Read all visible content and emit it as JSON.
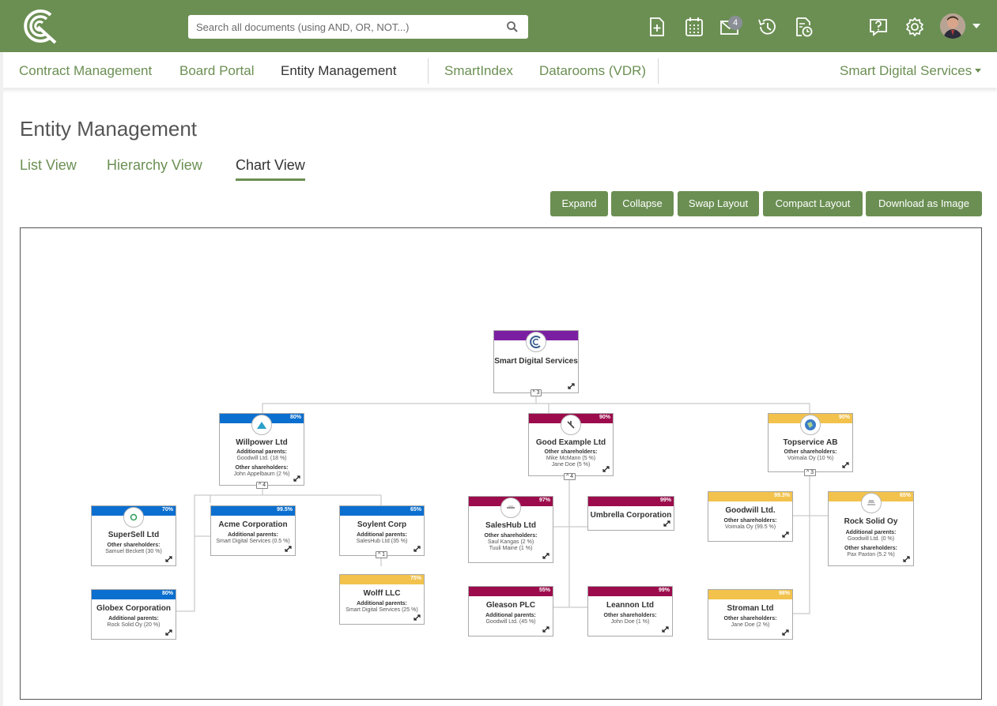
{
  "search": {
    "placeholder": "Search all documents (using AND, OR, NOT...)"
  },
  "topbar": {
    "notification_count": "4"
  },
  "nav": {
    "items": [
      "Contract Management",
      "Board Portal",
      "Entity Management",
      "SmartIndex",
      "Datarooms (VDR)"
    ],
    "company": "Smart Digital Services"
  },
  "page": {
    "title": "Entity Management",
    "tabs": [
      "List View",
      "Hierarchy View",
      "Chart View"
    ]
  },
  "buttons": {
    "expand": "Expand",
    "collapse": "Collapse",
    "swap": "Swap Layout",
    "compact": "Compact Layout",
    "download": "Download as Image"
  },
  "colors": {
    "brand_green": "#6b8f53",
    "purple": "#7b1fa2",
    "blue": "#0b6fcf",
    "maroon": "#9c0c4c",
    "gold": "#f2c24c"
  },
  "nodes": {
    "root": {
      "name": "Smart Digital Services",
      "toggle": "^ 3"
    },
    "willpower": {
      "pct": "80%",
      "name": "Willpower Ltd",
      "label1": "Additional parents:",
      "value1": "Goodwill Ltd. (18 %)",
      "label2": "Other shareholders:",
      "value2": "John Appelbaum (2 %)",
      "toggle": "^ 4"
    },
    "goodexample": {
      "pct": "90%",
      "name": "Good Example Ltd",
      "label1": "Other shareholders:",
      "value1": "Mike McMann (5 %)",
      "value2": "Jane Doe (5 %)",
      "toggle": "^ 4"
    },
    "topservice": {
      "pct": "90%",
      "name": "Topservice AB",
      "label1": "Other shareholders:",
      "value1": "Voimala Oy (10 %)",
      "toggle": "^ 3"
    },
    "supersell": {
      "pct": "70%",
      "name": "SuperSell Ltd",
      "label1": "Other shareholders:",
      "value1": "Samuel Beckett (30 %)"
    },
    "acme": {
      "pct": "99.5%",
      "name": "Acme Corporation",
      "label1": "Additional parents:",
      "value1": "Smart Digital Services (0.5 %)"
    },
    "soylent": {
      "pct": "65%",
      "name": "Soylent Corp",
      "label1": "Additional parents:",
      "value1": "SalesHub Ltd (35 %)",
      "toggle": "^ 1"
    },
    "wolff": {
      "pct": "75%",
      "name": "Wolff LLC",
      "label1": "Additional parents:",
      "value1": "Smart Digital Services (25 %)"
    },
    "globex": {
      "pct": "80%",
      "name": "Globex Corporation",
      "label1": "Additional parents:",
      "value1": "Rock Solid Oy (20 %)"
    },
    "saleshub": {
      "pct": "97%",
      "name": "SalesHub Ltd",
      "label1": "Other shareholders:",
      "value1": "Saul Kangas (2 %)",
      "value2": "Tuuli Maine (1 %)"
    },
    "umbrella": {
      "pct": "99%",
      "name": "Umbrella Corporation"
    },
    "gleason": {
      "pct": "55%",
      "name": "Gleason PLC",
      "label1": "Additional parents:",
      "value1": "Goodwill Ltd. (45 %)"
    },
    "leannon": {
      "pct": "99%",
      "name": "Leannon Ltd",
      "label1": "Other shareholders:",
      "value1": "John Doe (1 %)"
    },
    "goodwill": {
      "pct": "99.3%",
      "name": "Goodwill Ltd.",
      "label1": "Other shareholders:",
      "value1": "Voimala Oy (99.5 %)"
    },
    "rocksolid": {
      "pct": "65%",
      "name": "Rock Solid Oy",
      "label1": "Additional parents:",
      "value1": "Goodwill Ltd. (0 %)",
      "label2": "Other shareholders:",
      "value2": "Pax Paxton (5.2 %)"
    },
    "stroman": {
      "pct": "98%",
      "name": "Stroman Ltd",
      "label1": "Other shareholders:",
      "value1": "Jane Doe (2 %)"
    }
  }
}
